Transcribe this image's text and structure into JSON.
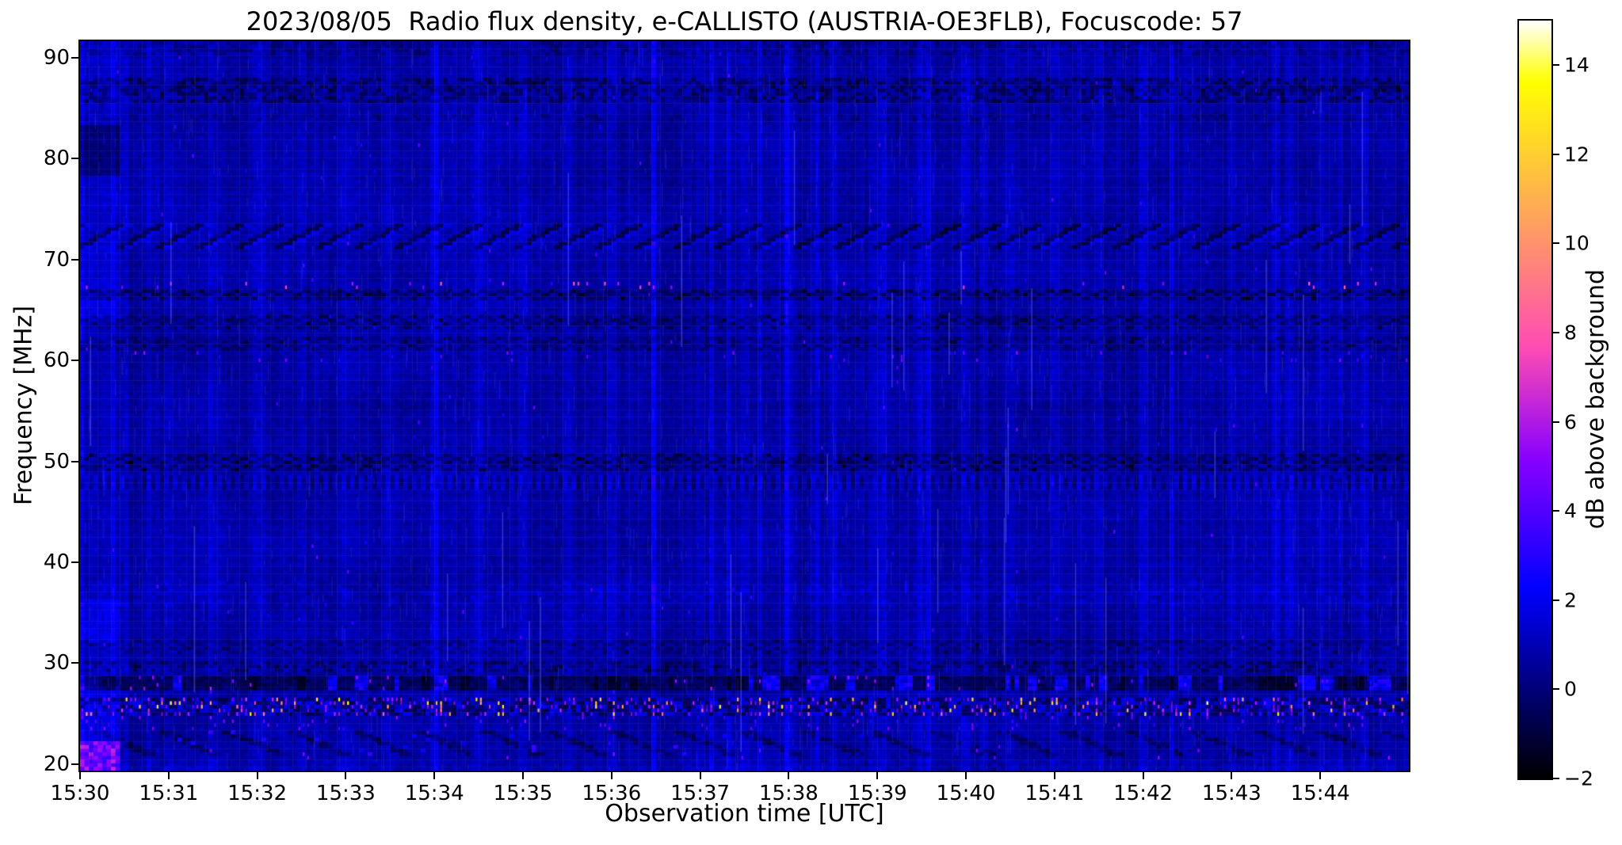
{
  "chart_data": {
    "type": "heatmap",
    "subtype": "radio-spectrogram",
    "title": "2023/08/05  Radio flux density, e-CALLISTO (AUSTRIA-OE3FLB), Focuscode: 57",
    "xlabel": "Observation time [UTC]",
    "ylabel": "Frequency [MHz]",
    "colorbar_label": "dB above background",
    "colormap": "gnuplot2",
    "x_tick_labels": [
      "15:30",
      "15:31",
      "15:32",
      "15:33",
      "15:34",
      "15:35",
      "15:36",
      "15:37",
      "15:38",
      "15:39",
      "15:40",
      "15:41",
      "15:42",
      "15:43",
      "15:44"
    ],
    "x_tick_minutes": [
      0,
      1,
      2,
      3,
      4,
      5,
      6,
      7,
      8,
      9,
      10,
      11,
      12,
      13,
      14
    ],
    "x_range_minutes": [
      0,
      15
    ],
    "y_tick_labels": [
      "90",
      "80",
      "70",
      "60",
      "50",
      "40",
      "30",
      "20"
    ],
    "y_tick_values": [
      90,
      80,
      70,
      60,
      50,
      40,
      30,
      20
    ],
    "y_range_mhz": [
      19.35,
      91.65
    ],
    "colorbar_tick_labels": [
      "14",
      "12",
      "10",
      "8",
      "6",
      "4",
      "2",
      "0",
      "−2"
    ],
    "colorbar_tick_values": [
      14,
      12,
      10,
      8,
      6,
      4,
      2,
      0,
      -2
    ],
    "colorbar_range_db": [
      -2,
      15
    ],
    "background_level_db": 0.75,
    "grid": false,
    "features": [
      {
        "name": "top-edge-speckle",
        "f_lo": 90.3,
        "f_hi": 91.65,
        "type": "dark_speckle",
        "depth": 0.8,
        "p": 0.45
      },
      {
        "name": "band-86-88-dark-mottle",
        "f_lo": 85.4,
        "f_hi": 87.9,
        "type": "dark_speckle",
        "depth": 1.35,
        "p": 0.55
      },
      {
        "name": "band-84-faint-dark",
        "f_lo": 83.7,
        "f_hi": 84.5,
        "type": "dark_speckle",
        "depth": 0.7,
        "p": 0.35
      },
      {
        "name": "band-72-73-zigzag-rfi",
        "f_lo": 71.2,
        "f_hi": 73.7,
        "type": "zigzag",
        "depth": 1.25
      },
      {
        "name": "line-67.5-pink-specks",
        "f_lo": 67.2,
        "f_hi": 67.9,
        "type": "sparse_bright",
        "p": 0.05,
        "v_lo": 4.5,
        "v_hi": 8.5
      },
      {
        "name": "band-66-67-dark",
        "f_lo": 65.9,
        "f_hi": 67.2,
        "type": "checker_dark",
        "depth": 1.5,
        "p": 0.5
      },
      {
        "name": "band-63-64.5-dark",
        "f_lo": 63.0,
        "f_hi": 64.7,
        "type": "checker_dark",
        "depth": 1.15,
        "p": 0.45
      },
      {
        "name": "band-61-62.5-dark",
        "f_lo": 60.8,
        "f_hi": 62.5,
        "type": "checker_dark",
        "depth": 1.0,
        "p": 0.4
      },
      {
        "name": "line-60.5-specks",
        "f_lo": 59.9,
        "f_hi": 60.8,
        "type": "sparse_bright",
        "p": 0.035,
        "v_lo": 2.5,
        "v_hi": 5.5
      },
      {
        "name": "band-49.5-51-dark",
        "f_lo": 49.0,
        "f_hi": 50.9,
        "type": "checker_dark",
        "depth": 1.3,
        "p": 0.5
      },
      {
        "name": "band-47.5-49-fine-stripes",
        "f_lo": 47.3,
        "f_hi": 48.8,
        "type": "fine_stripes",
        "amp": 0.75
      },
      {
        "name": "band-36-38-streaky-bright",
        "f_lo": 35.6,
        "f_hi": 38.1,
        "type": "soft_bright",
        "amp": 0.4
      },
      {
        "name": "band-31-32-dark",
        "f_lo": 30.9,
        "f_hi": 32.3,
        "type": "checker_dark",
        "depth": 0.85,
        "p": 0.4
      },
      {
        "name": "band-29.5-30-dark",
        "f_lo": 29.2,
        "f_hi": 30.1,
        "type": "dark_speckle",
        "depth": 1.25,
        "p": 0.5
      },
      {
        "name": "band-27.5-28.5-rfi-blotch",
        "f_lo": 27.3,
        "f_hi": 28.7,
        "type": "rfi_blotch"
      },
      {
        "name": "band-25-26.5-strong-rfi-specks",
        "f_lo": 24.9,
        "f_hi": 26.7,
        "type": "bright_noise"
      },
      {
        "name": "band-24-25-purple-specks",
        "f_lo": 23.4,
        "f_hi": 24.9,
        "type": "sparse_bright",
        "p": 0.07,
        "v_lo": 2.5,
        "v_hi": 5.5
      },
      {
        "name": "band-21-23-diagonal-dark",
        "f_lo": 20.8,
        "f_hi": 23.4,
        "type": "diag_dark",
        "depth": 1.15
      },
      {
        "name": "line-21-pink-blobs",
        "f_lo": 20.3,
        "f_hi": 21.6,
        "type": "sparse_bright",
        "p": 0.013,
        "v_lo": 3.5,
        "v_hi": 6.5
      },
      {
        "name": "bottom-edge-bright",
        "f_lo": 19.35,
        "f_hi": 20.3,
        "type": "soft_bright",
        "amp": 0.35
      }
    ],
    "startup_column": {
      "duration_s": 27,
      "default_add_db": 0.45,
      "boosts": [
        {
          "f_lo": 19.35,
          "f_hi": 22.3,
          "set_lo": 3.2,
          "set_hi": 6.5
        },
        {
          "f_lo": 22.3,
          "f_hi": 27.5,
          "add": 1.1
        },
        {
          "f_lo": 27.5,
          "f_hi": 32.0,
          "add": 0.6
        },
        {
          "f_lo": 32.0,
          "f_hi": 36.5,
          "add": 1.2
        },
        {
          "f_lo": 64.0,
          "f_hi": 71.5,
          "add": 0.9
        },
        {
          "f_lo": 78.3,
          "f_hi": 83.2,
          "add": -0.9
        }
      ]
    },
    "render": {
      "seed": 42,
      "n_cols": 300,
      "n_rows": 200
    }
  }
}
